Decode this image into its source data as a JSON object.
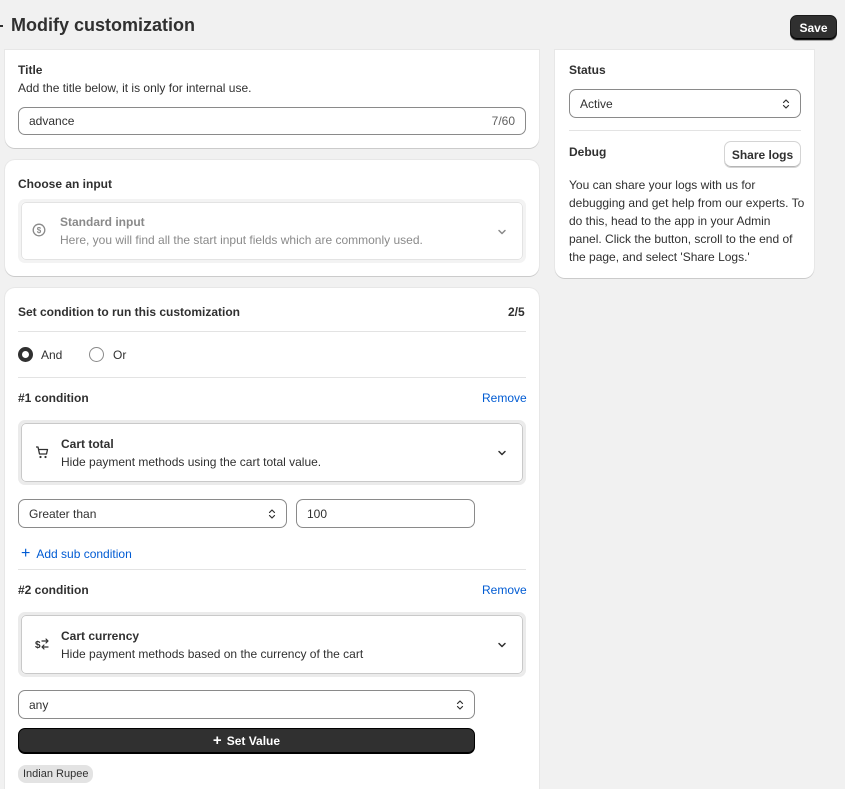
{
  "header": {
    "title": "Modify customization",
    "save_label": "Save"
  },
  "title_card": {
    "heading": "Title",
    "help": "Add the title below, it is only for internal use.",
    "input_value": "advance",
    "char_count": "7/60"
  },
  "input_card": {
    "heading": "Choose an input",
    "option_title": "Standard input",
    "option_desc": "Here, you will find all the start input fields which are commonly used."
  },
  "conditions_card": {
    "heading": "Set condition to run this customization",
    "count": "2/5",
    "logic": {
      "and_label": "And",
      "or_label": "Or",
      "selected": "And"
    },
    "remove_label": "Remove",
    "condition1": {
      "label": "#1 condition",
      "type_title": "Cart total",
      "type_desc": "Hide payment methods using the cart total value.",
      "operator": "Greater than",
      "value": "100",
      "add_sub_label": "Add sub condition"
    },
    "condition2": {
      "label": "#2 condition",
      "type_title": "Cart currency",
      "type_desc": "Hide payment methods based on the currency of the cart",
      "operator": "any",
      "set_value_label": "Set Value",
      "tags": [
        "Indian Rupee"
      ]
    }
  },
  "side_card": {
    "status_heading": "Status",
    "status_value": "Active",
    "debug_heading": "Debug",
    "share_logs_label": "Share logs",
    "debug_text": "You can share your logs with us for debugging and get help from our experts. To do this, head to the app in your Admin panel. Click the button, scroll to the end of the page, and select 'Share Logs.'"
  },
  "colors": {
    "primary": "#303030",
    "link": "#005bd3",
    "background": "#f1f1f1",
    "card": "#ffffff"
  }
}
